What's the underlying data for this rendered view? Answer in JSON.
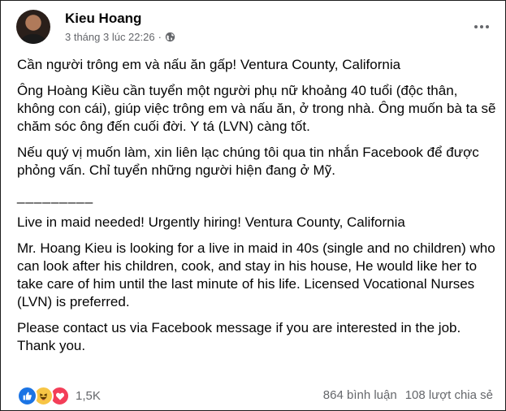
{
  "post": {
    "author": "Kieu Hoang",
    "timestamp": "3 tháng 3 lúc 22:26",
    "separator": "·",
    "privacy_icon": "globe-icon",
    "more_icon": "more-options-icon"
  },
  "content": {
    "vi_title": "Cần người trông em và nấu ăn gấp! Ventura County, California",
    "vi_body": "Ông Hoàng Kiều cần tuyển một người phụ nữ khoảng 40 tuổi (độc thân, không con cái), giúp việc trông em và nấu ăn, ở trong nhà. Ông muốn bà ta sẽ chăm sóc ông đến cuối đời. Y tá (LVN) càng tốt.",
    "vi_contact": "Nếu quý vị muốn làm, xin liên lạc chúng tôi qua tin nhắn Facebook để được phỏng vấn. Chỉ tuyển những người hiện đang ở Mỹ.",
    "divider": "_________",
    "en_title": "Live in maid needed! Urgently hiring! Ventura County, California",
    "en_body": "Mr. Hoang Kieu is looking for a live in maid  in 40s (single and no children) who can look after his children, cook, and stay in his house, He would like her to take care of him until the last minute of his life. Licensed Vocational Nurses (LVN) is preferred.",
    "en_contact": "Please contact us via Facebook message if you are interested in the job. Thank you."
  },
  "footer": {
    "reactions": [
      "like-icon",
      "haha-icon",
      "love-icon"
    ],
    "reaction_count": "1,5K",
    "comments": "864 bình luận",
    "shares": "108 lượt chia sẻ"
  },
  "colors": {
    "text": "#050505",
    "secondary": "#65676b",
    "like": "#1b74e4",
    "haha": "#f7c545",
    "love": "#f33e58"
  }
}
